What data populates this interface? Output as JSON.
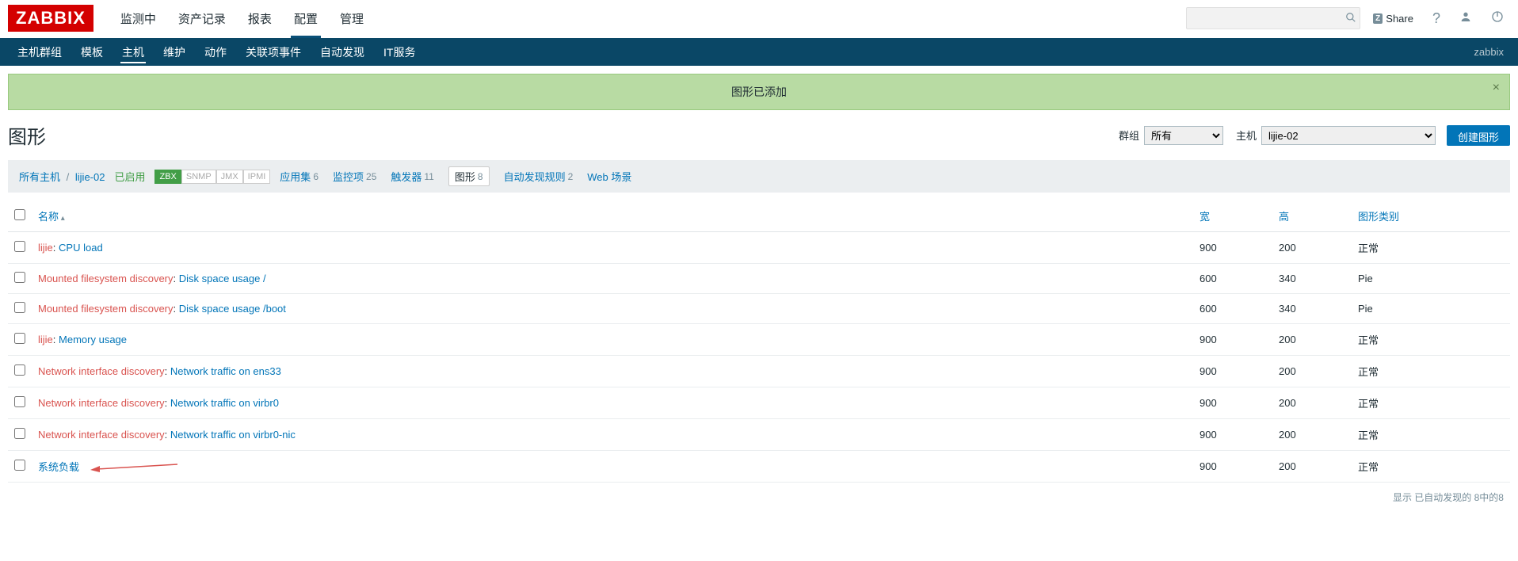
{
  "logo": "ZABBIX",
  "top_nav": {
    "items": [
      "监测中",
      "资产记录",
      "报表",
      "配置",
      "管理"
    ],
    "active_index": 3
  },
  "top_right": {
    "share_label": "Share",
    "share_badge": "Z"
  },
  "sub_nav": {
    "items": [
      "主机群组",
      "模板",
      "主机",
      "维护",
      "动作",
      "关联项事件",
      "自动发现",
      "IT服务"
    ],
    "active_index": 2,
    "right_text": "zabbix"
  },
  "alert": {
    "message": "图形已添加"
  },
  "page_title": "图形",
  "filters": {
    "group_label": "群组",
    "group_value": "所有",
    "host_label": "主机",
    "host_value": "lijie-02"
  },
  "create_button": "创建图形",
  "breadcrumb": {
    "all_hosts": "所有主机",
    "host": "lijie-02",
    "status": "已启用"
  },
  "tags": [
    "ZBX",
    "SNMP",
    "JMX",
    "IPMI"
  ],
  "host_tabs": [
    {
      "label": "应用集",
      "count": "6"
    },
    {
      "label": "监控项",
      "count": "25"
    },
    {
      "label": "触发器",
      "count": "11"
    },
    {
      "label": "图形",
      "count": "8",
      "active": true
    },
    {
      "label": "自动发现规则",
      "count": "2"
    },
    {
      "label": "Web 场景",
      "count": ""
    }
  ],
  "table": {
    "headers": {
      "name": "名称",
      "width": "宽",
      "height": "高",
      "type": "图形类别"
    },
    "rows": [
      {
        "template": "lijie",
        "name": "CPU load",
        "width": "900",
        "height": "200",
        "type": "正常",
        "arrow": false
      },
      {
        "template": "Mounted filesystem discovery",
        "name": "Disk space usage /",
        "width": "600",
        "height": "340",
        "type": "Pie",
        "arrow": false
      },
      {
        "template": "Mounted filesystem discovery",
        "name": "Disk space usage /boot",
        "width": "600",
        "height": "340",
        "type": "Pie",
        "arrow": false
      },
      {
        "template": "lijie",
        "name": "Memory usage",
        "width": "900",
        "height": "200",
        "type": "正常",
        "arrow": false
      },
      {
        "template": "Network interface discovery",
        "name": "Network traffic on ens33",
        "width": "900",
        "height": "200",
        "type": "正常",
        "arrow": false
      },
      {
        "template": "Network interface discovery",
        "name": "Network traffic on virbr0",
        "width": "900",
        "height": "200",
        "type": "正常",
        "arrow": false
      },
      {
        "template": "Network interface discovery",
        "name": "Network traffic on virbr0-nic",
        "width": "900",
        "height": "200",
        "type": "正常",
        "arrow": false
      },
      {
        "template": "",
        "name": "系统负载",
        "width": "900",
        "height": "200",
        "type": "正常",
        "arrow": true
      }
    ]
  },
  "footer": "显示 已自动发现的 8中的8"
}
